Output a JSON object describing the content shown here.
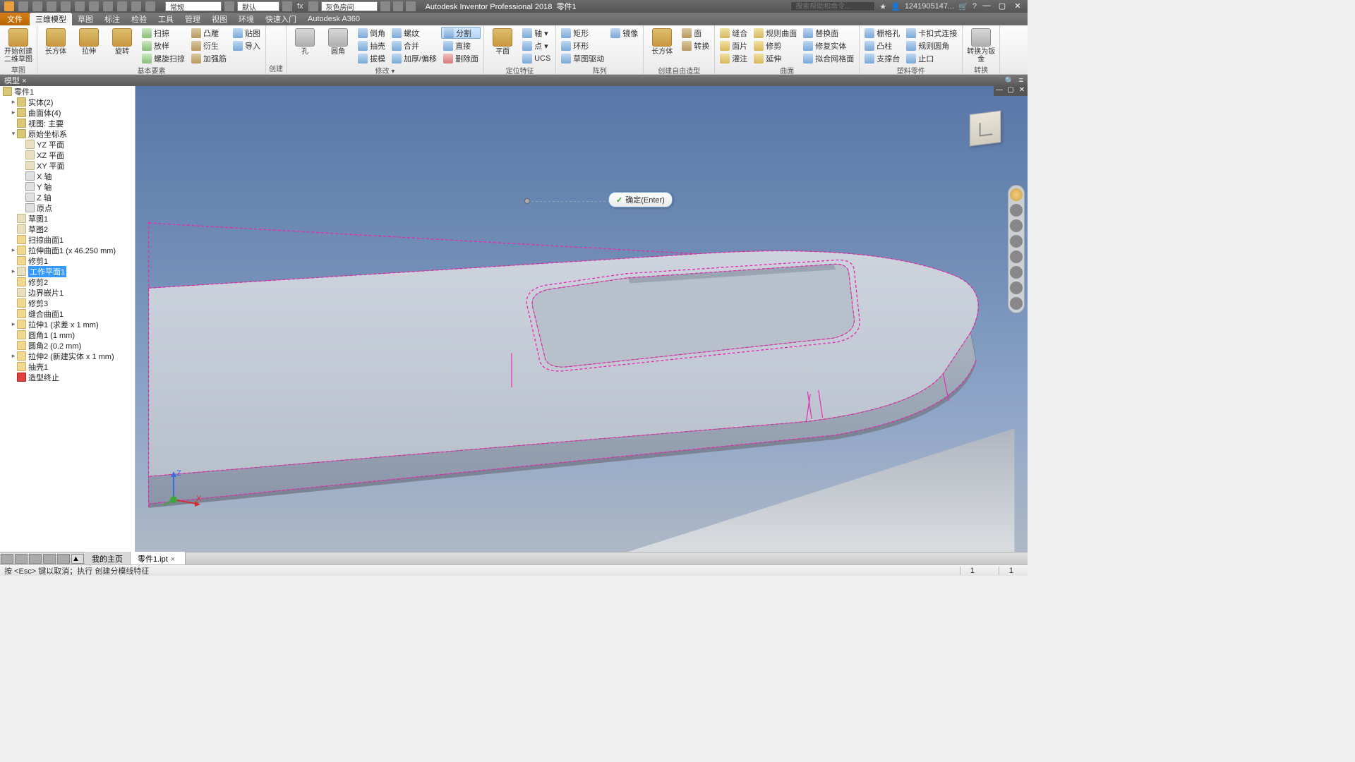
{
  "app": {
    "name": "Autodesk Inventor Professional 2018",
    "doc": "零件1"
  },
  "title_bar": {
    "combo_normal": "常规",
    "combo_default": "默认",
    "combo_material": "灰色房间",
    "search_placeholder": "搜索帮助和命令...",
    "user": "1241905147..."
  },
  "tabs": {
    "file": "文件",
    "items": [
      "三维模型",
      "草图",
      "标注",
      "检验",
      "工具",
      "管理",
      "视图",
      "环境",
      "快速入门",
      "Autodesk A360"
    ],
    "active_index": 0
  },
  "ribbon": {
    "groups": [
      {
        "label": "草图",
        "big": [
          {
            "t": "开始创建\n二维草图",
            "c": "y"
          }
        ],
        "cols": []
      },
      {
        "label": "基本要素",
        "big": [
          {
            "t": "长方体",
            "c": "y"
          },
          {
            "t": "拉伸",
            "c": "y"
          },
          {
            "t": "旋转",
            "c": "y"
          }
        ],
        "cols": [
          [
            {
              "t": "扫掠",
              "i": "g"
            },
            {
              "t": "放样",
              "i": "g"
            },
            {
              "t": "螺旋扫掠",
              "i": "g"
            }
          ],
          [
            {
              "t": "凸雕",
              "i": "br"
            },
            {
              "t": "衍生",
              "i": "br"
            },
            {
              "t": "加强筋",
              "i": "br"
            }
          ],
          [
            {
              "t": "贴图",
              "i": "b"
            },
            {
              "t": "导入",
              "i": "b"
            },
            {
              "t": "",
              "i": ""
            }
          ]
        ]
      },
      {
        "label": "创建",
        "big": [],
        "cols": []
      },
      {
        "label": "修改 ▾",
        "big": [
          {
            "t": "孔",
            "c": "gray"
          },
          {
            "t": "圆角",
            "c": "gray"
          }
        ],
        "cols": [
          [
            {
              "t": "倒角",
              "i": "b"
            },
            {
              "t": "抽壳",
              "i": "b"
            },
            {
              "t": "拔模",
              "i": "b"
            }
          ],
          [
            {
              "t": "螺纹",
              "i": "b"
            },
            {
              "t": "合并",
              "i": "b"
            },
            {
              "t": "加厚/偏移",
              "i": "b"
            }
          ],
          [
            {
              "t": "分割",
              "i": "b",
              "active": true
            },
            {
              "t": "直接",
              "i": "b"
            },
            {
              "t": "删除面",
              "i": "r"
            }
          ]
        ]
      },
      {
        "label": "定位特征",
        "big": [
          {
            "t": "平面",
            "c": "y"
          }
        ],
        "cols": [
          [
            {
              "t": "轴 ▾",
              "i": "b"
            },
            {
              "t": "点 ▾",
              "i": "b"
            },
            {
              "t": "UCS",
              "i": "b"
            }
          ]
        ]
      },
      {
        "label": "阵列",
        "big": [],
        "cols": [
          [
            {
              "t": "矩形",
              "i": "b"
            },
            {
              "t": "环形",
              "i": "b"
            },
            {
              "t": "草图驱动",
              "i": "b"
            }
          ],
          [
            {
              "t": "镜像",
              "i": "b"
            },
            {
              "t": "",
              "i": ""
            },
            {
              "t": "",
              "i": ""
            }
          ]
        ]
      },
      {
        "label": "创建自由造型",
        "big": [
          {
            "t": "长方体",
            "c": "br"
          }
        ],
        "cols": [
          [
            {
              "t": "面",
              "i": "br"
            },
            {
              "t": "转换",
              "i": "br"
            },
            {
              "t": "",
              "i": ""
            }
          ]
        ]
      },
      {
        "label": "曲面",
        "big": [],
        "cols": [
          [
            {
              "t": "缝合",
              "i": "y"
            },
            {
              "t": "面片",
              "i": "y"
            },
            {
              "t": "灌注",
              "i": "y"
            }
          ],
          [
            {
              "t": "规则曲面",
              "i": "y"
            },
            {
              "t": "修剪",
              "i": "y"
            },
            {
              "t": "延伸",
              "i": "y"
            }
          ],
          [
            {
              "t": "替换面",
              "i": "b"
            },
            {
              "t": "修复实体",
              "i": "b"
            },
            {
              "t": "拟合网格面",
              "i": "b"
            }
          ]
        ]
      },
      {
        "label": "塑料零件",
        "big": [],
        "cols": [
          [
            {
              "t": "栅格孔",
              "i": "b"
            },
            {
              "t": "凸柱",
              "i": "b"
            },
            {
              "t": "支撑台",
              "i": "b"
            }
          ],
          [
            {
              "t": "卡扣式连接",
              "i": "b"
            },
            {
              "t": "规则圆角",
              "i": "b"
            },
            {
              "t": "止口",
              "i": "b"
            }
          ]
        ]
      },
      {
        "label": "转换",
        "big": [
          {
            "t": "转换为钣金",
            "c": "gray"
          }
        ],
        "cols": []
      }
    ]
  },
  "panel_strip": {
    "title": "模型",
    "close": "×"
  },
  "tree": {
    "root": "零件1",
    "items": [
      {
        "lvl": 1,
        "arrow": ">",
        "ico": "box",
        "t": "实体(2)"
      },
      {
        "lvl": 1,
        "arrow": ">",
        "ico": "box",
        "t": "曲面体(4)"
      },
      {
        "lvl": 1,
        "arrow": "",
        "ico": "box",
        "t": "视图: 主要"
      },
      {
        "lvl": 1,
        "arrow": "v",
        "ico": "box",
        "t": "原始坐标系"
      },
      {
        "lvl": 2,
        "arrow": "",
        "ico": "plane",
        "t": "YZ 平面"
      },
      {
        "lvl": 2,
        "arrow": "",
        "ico": "plane",
        "t": "XZ 平面"
      },
      {
        "lvl": 2,
        "arrow": "",
        "ico": "plane",
        "t": "XY 平面"
      },
      {
        "lvl": 2,
        "arrow": "",
        "ico": "axis",
        "t": "X 轴"
      },
      {
        "lvl": 2,
        "arrow": "",
        "ico": "axis",
        "t": "Y 轴"
      },
      {
        "lvl": 2,
        "arrow": "",
        "ico": "axis",
        "t": "Z 轴"
      },
      {
        "lvl": 2,
        "arrow": "",
        "ico": "axis",
        "t": "原点"
      },
      {
        "lvl": 1,
        "arrow": "",
        "ico": "plane",
        "t": "草图1"
      },
      {
        "lvl": 1,
        "arrow": "",
        "ico": "plane",
        "t": "草图2"
      },
      {
        "lvl": 1,
        "arrow": "",
        "ico": "ext",
        "t": "扫掠曲面1"
      },
      {
        "lvl": 1,
        "arrow": ">",
        "ico": "ext",
        "t": "拉伸曲面1 (x 46.250 mm)"
      },
      {
        "lvl": 1,
        "arrow": "",
        "ico": "ext",
        "t": "修剪1"
      },
      {
        "lvl": 1,
        "arrow": ">",
        "ico": "plane",
        "t": "工作平面1",
        "sel": true
      },
      {
        "lvl": 1,
        "arrow": "",
        "ico": "ext",
        "t": "修剪2"
      },
      {
        "lvl": 1,
        "arrow": "",
        "ico": "plane",
        "t": "边界嵌片1"
      },
      {
        "lvl": 1,
        "arrow": "",
        "ico": "ext",
        "t": "修剪3"
      },
      {
        "lvl": 1,
        "arrow": "",
        "ico": "ext",
        "t": "缝合曲面1"
      },
      {
        "lvl": 1,
        "arrow": ">",
        "ico": "ext",
        "t": "拉伸1 (求差 x 1 mm)"
      },
      {
        "lvl": 1,
        "arrow": "",
        "ico": "ext",
        "t": "圆角1 (1 mm)"
      },
      {
        "lvl": 1,
        "arrow": "",
        "ico": "ext",
        "t": "圆角2 (0.2 mm)"
      },
      {
        "lvl": 1,
        "arrow": ">",
        "ico": "ext",
        "t": "拉伸2 (新建实体 x 1 mm)"
      },
      {
        "lvl": 1,
        "arrow": "",
        "ico": "ext",
        "t": "抽壳1"
      },
      {
        "lvl": 1,
        "arrow": "",
        "ico": "red",
        "t": "造型终止"
      }
    ]
  },
  "bubble": {
    "text": "确定(Enter)"
  },
  "triad": {
    "z": "Z",
    "x": "X"
  },
  "docbar": {
    "home": "我的主页",
    "doc": "零件1.ipt"
  },
  "status": {
    "msg": "按 <Esc> 键以取消；执行 创建分模线特征",
    "n1": "1",
    "n2": "1"
  }
}
